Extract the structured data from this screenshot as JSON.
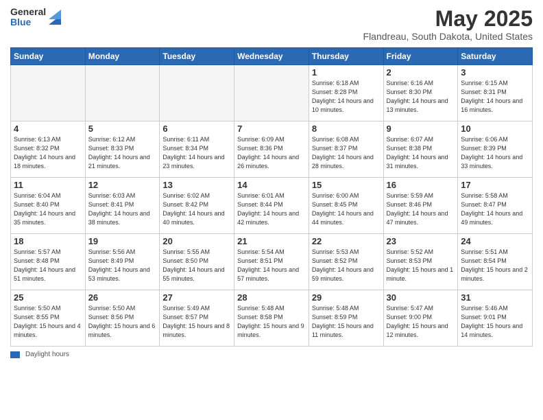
{
  "header": {
    "logo_general": "General",
    "logo_blue": "Blue",
    "month_title": "May 2025",
    "subtitle": "Flandreau, South Dakota, United States"
  },
  "weekdays": [
    "Sunday",
    "Monday",
    "Tuesday",
    "Wednesday",
    "Thursday",
    "Friday",
    "Saturday"
  ],
  "weeks": [
    [
      {
        "day": "",
        "empty": true
      },
      {
        "day": "",
        "empty": true
      },
      {
        "day": "",
        "empty": true
      },
      {
        "day": "",
        "empty": true
      },
      {
        "day": "1",
        "sunrise": "6:18 AM",
        "sunset": "8:28 PM",
        "daylight": "14 hours and 10 minutes."
      },
      {
        "day": "2",
        "sunrise": "6:16 AM",
        "sunset": "8:30 PM",
        "daylight": "14 hours and 13 minutes."
      },
      {
        "day": "3",
        "sunrise": "6:15 AM",
        "sunset": "8:31 PM",
        "daylight": "14 hours and 16 minutes."
      }
    ],
    [
      {
        "day": "4",
        "sunrise": "6:13 AM",
        "sunset": "8:32 PM",
        "daylight": "14 hours and 18 minutes."
      },
      {
        "day": "5",
        "sunrise": "6:12 AM",
        "sunset": "8:33 PM",
        "daylight": "14 hours and 21 minutes."
      },
      {
        "day": "6",
        "sunrise": "6:11 AM",
        "sunset": "8:34 PM",
        "daylight": "14 hours and 23 minutes."
      },
      {
        "day": "7",
        "sunrise": "6:09 AM",
        "sunset": "8:36 PM",
        "daylight": "14 hours and 26 minutes."
      },
      {
        "day": "8",
        "sunrise": "6:08 AM",
        "sunset": "8:37 PM",
        "daylight": "14 hours and 28 minutes."
      },
      {
        "day": "9",
        "sunrise": "6:07 AM",
        "sunset": "8:38 PM",
        "daylight": "14 hours and 31 minutes."
      },
      {
        "day": "10",
        "sunrise": "6:06 AM",
        "sunset": "8:39 PM",
        "daylight": "14 hours and 33 minutes."
      }
    ],
    [
      {
        "day": "11",
        "sunrise": "6:04 AM",
        "sunset": "8:40 PM",
        "daylight": "14 hours and 35 minutes."
      },
      {
        "day": "12",
        "sunrise": "6:03 AM",
        "sunset": "8:41 PM",
        "daylight": "14 hours and 38 minutes."
      },
      {
        "day": "13",
        "sunrise": "6:02 AM",
        "sunset": "8:42 PM",
        "daylight": "14 hours and 40 minutes."
      },
      {
        "day": "14",
        "sunrise": "6:01 AM",
        "sunset": "8:44 PM",
        "daylight": "14 hours and 42 minutes."
      },
      {
        "day": "15",
        "sunrise": "6:00 AM",
        "sunset": "8:45 PM",
        "daylight": "14 hours and 44 minutes."
      },
      {
        "day": "16",
        "sunrise": "5:59 AM",
        "sunset": "8:46 PM",
        "daylight": "14 hours and 47 minutes."
      },
      {
        "day": "17",
        "sunrise": "5:58 AM",
        "sunset": "8:47 PM",
        "daylight": "14 hours and 49 minutes."
      }
    ],
    [
      {
        "day": "18",
        "sunrise": "5:57 AM",
        "sunset": "8:48 PM",
        "daylight": "14 hours and 51 minutes."
      },
      {
        "day": "19",
        "sunrise": "5:56 AM",
        "sunset": "8:49 PM",
        "daylight": "14 hours and 53 minutes."
      },
      {
        "day": "20",
        "sunrise": "5:55 AM",
        "sunset": "8:50 PM",
        "daylight": "14 hours and 55 minutes."
      },
      {
        "day": "21",
        "sunrise": "5:54 AM",
        "sunset": "8:51 PM",
        "daylight": "14 hours and 57 minutes."
      },
      {
        "day": "22",
        "sunrise": "5:53 AM",
        "sunset": "8:52 PM",
        "daylight": "14 hours and 59 minutes."
      },
      {
        "day": "23",
        "sunrise": "5:52 AM",
        "sunset": "8:53 PM",
        "daylight": "15 hours and 1 minute."
      },
      {
        "day": "24",
        "sunrise": "5:51 AM",
        "sunset": "8:54 PM",
        "daylight": "15 hours and 2 minutes."
      }
    ],
    [
      {
        "day": "25",
        "sunrise": "5:50 AM",
        "sunset": "8:55 PM",
        "daylight": "15 hours and 4 minutes."
      },
      {
        "day": "26",
        "sunrise": "5:50 AM",
        "sunset": "8:56 PM",
        "daylight": "15 hours and 6 minutes."
      },
      {
        "day": "27",
        "sunrise": "5:49 AM",
        "sunset": "8:57 PM",
        "daylight": "15 hours and 8 minutes."
      },
      {
        "day": "28",
        "sunrise": "5:48 AM",
        "sunset": "8:58 PM",
        "daylight": "15 hours and 9 minutes."
      },
      {
        "day": "29",
        "sunrise": "5:48 AM",
        "sunset": "8:59 PM",
        "daylight": "15 hours and 11 minutes."
      },
      {
        "day": "30",
        "sunrise": "5:47 AM",
        "sunset": "9:00 PM",
        "daylight": "15 hours and 12 minutes."
      },
      {
        "day": "31",
        "sunrise": "5:46 AM",
        "sunset": "9:01 PM",
        "daylight": "15 hours and 14 minutes."
      }
    ]
  ],
  "footer": {
    "daylight_label": "Daylight hours"
  }
}
